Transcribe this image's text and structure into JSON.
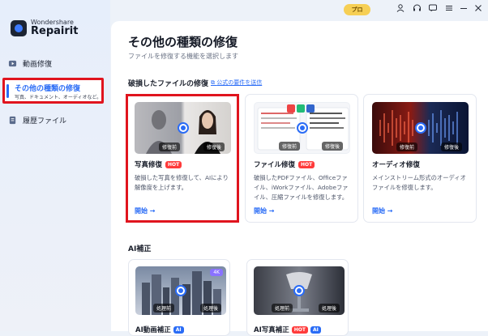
{
  "app": {
    "logo_small": "Wondershare",
    "logo_big": "Repairit"
  },
  "topbar": {
    "pro_label": "プロ",
    "icons": [
      "user-icon",
      "headset-icon",
      "chat-icon",
      "menu-icon",
      "minimize-icon",
      "close-icon"
    ]
  },
  "sidebar": {
    "items": [
      {
        "label": "動画修復",
        "icon": "video-icon"
      },
      {
        "label": "その他の種類の修復",
        "sub": "写真、ドキュメント、オーディオなど。",
        "icon": "repair-icon"
      },
      {
        "label": "履歴ファイル",
        "icon": "history-icon"
      }
    ]
  },
  "main": {
    "title": "その他の種類の修復",
    "subtitle": "ファイルを修復する機能を選択します",
    "section_title": "破損したファイルの修復",
    "section_link": "公式の要件を送信",
    "cards": [
      {
        "title": "写真修復",
        "badge": "HOT",
        "desc": "破損した写真を修復して、AIにより解像度を上げます。",
        "start": "開始",
        "tag_before": "修復前",
        "tag_after": "修復後"
      },
      {
        "title": "ファイル修復",
        "badge": "HOT",
        "desc": "破損したPDFファイル、Officeファイル、iWorkファイル、Adobeファイル、圧縮ファイルを修復します。",
        "start": "開始",
        "tag_before": "修復前",
        "tag_after": "修復後"
      },
      {
        "title": "オーディオ修復",
        "badge": "",
        "desc": "メインストリーム形式のオーディオファイルを修復します。",
        "start": "開始",
        "tag_before": "修復前",
        "tag_after": "修復後"
      }
    ],
    "ai_section": "AI補正",
    "ai_cards": [
      {
        "title": "AI動画補正",
        "badge": "AI",
        "tag_before": "処理前",
        "tag_after": "処理後",
        "corner": "4K"
      },
      {
        "title": "AI写真補正",
        "badge_hot": "HOT",
        "badge": "AI",
        "tag_before": "処理前",
        "tag_after": "処理後"
      }
    ]
  }
}
